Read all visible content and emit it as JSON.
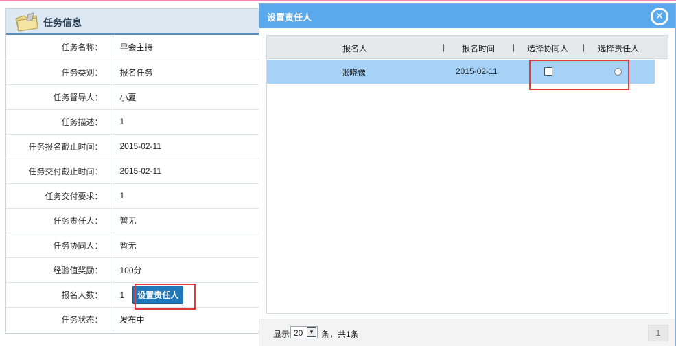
{
  "task_panel": {
    "title": "任务信息",
    "rows": [
      {
        "label": "任务名称：",
        "value": "早会主持"
      },
      {
        "label": "任务类别：",
        "value": "报名任务"
      },
      {
        "label": "任务督导人：",
        "value": "小夏"
      },
      {
        "label": "任务描述：",
        "value": "1"
      },
      {
        "label": "任务报名截止时间：",
        "value": "2015-02-11"
      },
      {
        "label": "任务交付截止时间：",
        "value": "2015-02-11"
      },
      {
        "label": "任务交付要求：",
        "value": "1"
      },
      {
        "label": "任务责任人：",
        "value": "暂无"
      },
      {
        "label": "任务协同人：",
        "value": "暂无"
      },
      {
        "label": "经验值奖励：",
        "value": "100分"
      },
      {
        "label": "报名人数：",
        "value": "1"
      },
      {
        "label": "任务状态：",
        "value": "发布中"
      }
    ],
    "set_button_label": "设置责任人"
  },
  "dialog": {
    "title": "设置责任人",
    "close_glyph": "✕",
    "columns": [
      "报名人",
      "报名时间",
      "选择协同人",
      "选择责任人"
    ],
    "separator": "|",
    "rows": [
      {
        "name": "张晓豫",
        "time": "2015-02-11",
        "collaborator_checked": false,
        "owner_selected": false
      }
    ],
    "footer": {
      "show_label": "显示",
      "page_size": "20",
      "summary": "条，共1条",
      "page_number": "1"
    }
  },
  "colors": {
    "dialog_title_bg": "#5aa9ec",
    "selected_row_bg": "#a6d2f8",
    "button_bg": "#1f76b8",
    "highlight_border": "#e53935"
  }
}
